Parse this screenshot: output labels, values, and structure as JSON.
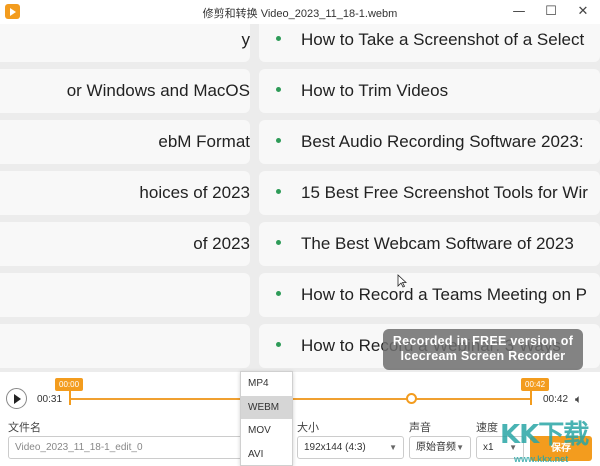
{
  "window": {
    "title": "修剪和转换 Video_2023_11_18-1.webm",
    "controls": {
      "minimize": "—",
      "maximize": "☐",
      "close": "✕"
    }
  },
  "video": {
    "left_items": [
      "y",
      "or Windows and MacOS",
      "ebM Format",
      "hoices of 2023",
      "of 2023",
      "",
      ""
    ],
    "right_items": [
      "How to Take a Screenshot of a Select",
      "How to Trim Videos",
      "Best Audio Recording Software 2023:",
      "15 Best Free Screenshot Tools for Wir",
      "The Best Webcam Software of 2023",
      "How to Record a Teams Meeting on P",
      "How to Record a Webinar: 3 Ways"
    ],
    "watermark_line1": "Recorded in FREE version of",
    "watermark_line2": "Icecream  Screen  Recorder",
    "bullet_color": "#2e9b58"
  },
  "timeline": {
    "current_time": "00:31",
    "end_time": "00:42",
    "start_marker": "00:00",
    "end_marker": "00:42",
    "accent_color": "#f39c1e"
  },
  "format_dropdown": {
    "options": [
      "MP4",
      "WEBM",
      "MOV",
      "AVI"
    ],
    "selected": "WEBM"
  },
  "controls": {
    "filename_label": "文件名",
    "filename_value": "Video_2023_11_18-1_edit_0",
    "size_label": "大小",
    "size_value": "192x144 (4:3)",
    "audio_label": "声音",
    "audio_value": "原始音频",
    "speed_label": "速度",
    "speed_value": "x1",
    "save_label": "保存"
  },
  "site_watermark": {
    "logo": "KK下载",
    "url": "www.kkx.net"
  }
}
